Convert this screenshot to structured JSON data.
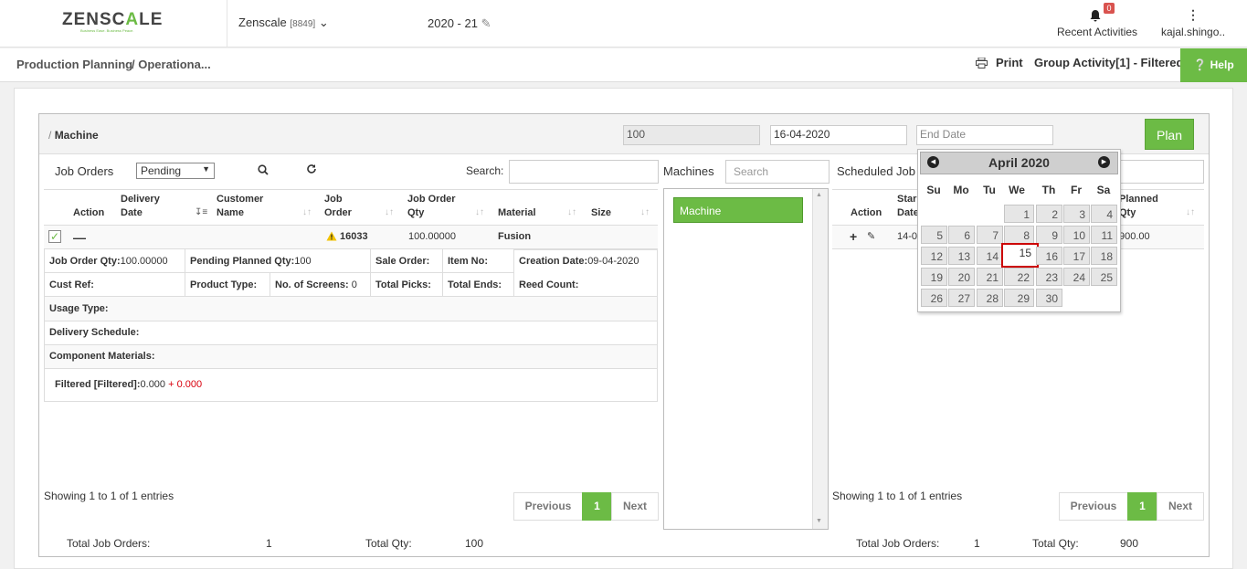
{
  "header": {
    "logo_text_a": "ZENSC",
    "logo_text_b": "A",
    "logo_text_c": "LE",
    "logo_tagline": "Business Ease. Business Peace.",
    "company": "Zenscale",
    "company_code": "[8849]",
    "fiscal_year": "2020 - 21",
    "notif_count": "0",
    "recent_label": "Recent Activities",
    "user": "kajal.shingo.."
  },
  "subbar": {
    "crumb1": "Production Planning",
    "crumb2": "/ Operationa...",
    "print": "Print",
    "group_activity": "Group Activity[1] - Filtered",
    "help": "Help"
  },
  "form": {
    "title_sep": "/",
    "title": "Machine",
    "qty": "100",
    "start_date": "16-04-2020",
    "end_placeholder": "End Date",
    "plan_label": "Plan"
  },
  "job_orders": {
    "title": "Job Orders",
    "status": "Pending",
    "search_label": "Search:",
    "columns": [
      "Action",
      "Delivery Date",
      "Customer Name",
      "Job Order",
      "Job Order Qty",
      "Material",
      "Size"
    ],
    "row": {
      "job_order": "16033",
      "qty": "100.00000",
      "material": "Fusion"
    },
    "details": {
      "jo_qty": "Job Order Qty:",
      "jo_qty_v": "100.00000",
      "pending": "Pending Planned Qty:",
      "pending_v": "100",
      "sale_order": "Sale Order:",
      "item_no": "Item No:",
      "creation": "Creation Date:",
      "creation_v": "09-04-2020",
      "cust_ref": "Cust Ref:",
      "product_type": "Product Type:",
      "screens": "No. of Screens:",
      "screens_v": "0",
      "total_picks": "Total Picks:",
      "total_ends": "Total Ends:",
      "reed": "Reed Count:",
      "usage": "Usage Type:",
      "delivery": "Delivery Schedule:",
      "component": "Component Materials:",
      "filtered": "Filtered [Filtered]:",
      "filtered_v": "0.000",
      "filtered_add": "+ 0.000"
    },
    "showing": "Showing 1 to 1 of 1 entries",
    "prev": "Previous",
    "page": "1",
    "next": "Next",
    "total_jo_label": "Total Job Orders:",
    "total_jo": "1",
    "total_qty_label": "Total Qty:",
    "total_qty": "100"
  },
  "machines": {
    "title": "Machines",
    "search_placeholder": "Search",
    "item": "Machine"
  },
  "scheduled": {
    "title": "Scheduled Job",
    "col_action": "Action",
    "col_start": "Star",
    "col_start2": "Date",
    "col_planned": "Planned",
    "col_planned2": "Qty",
    "row_start": "14-0",
    "row_qty": "900.00",
    "showing": "Showing 1 to 1 of 1 entries",
    "prev": "Previous",
    "page": "1",
    "next": "Next",
    "total_jo_label": "Total Job Orders:",
    "total_jo": "1",
    "total_qty_label": "Total Qty:",
    "total_qty": "900"
  },
  "calendar": {
    "title": "April 2020",
    "dow": [
      "Su",
      "Mo",
      "Tu",
      "We",
      "Th",
      "Fr",
      "Sa"
    ],
    "weeks": [
      [
        "",
        "",
        "",
        "1",
        "2",
        "3",
        "4"
      ],
      [
        "5",
        "6",
        "7",
        "8",
        "9",
        "10",
        "11"
      ],
      [
        "12",
        "13",
        "14",
        "15",
        "16",
        "17",
        "18"
      ],
      [
        "19",
        "20",
        "21",
        "22",
        "23",
        "24",
        "25"
      ],
      [
        "26",
        "27",
        "28",
        "29",
        "30",
        "",
        ""
      ]
    ],
    "today": "15"
  }
}
